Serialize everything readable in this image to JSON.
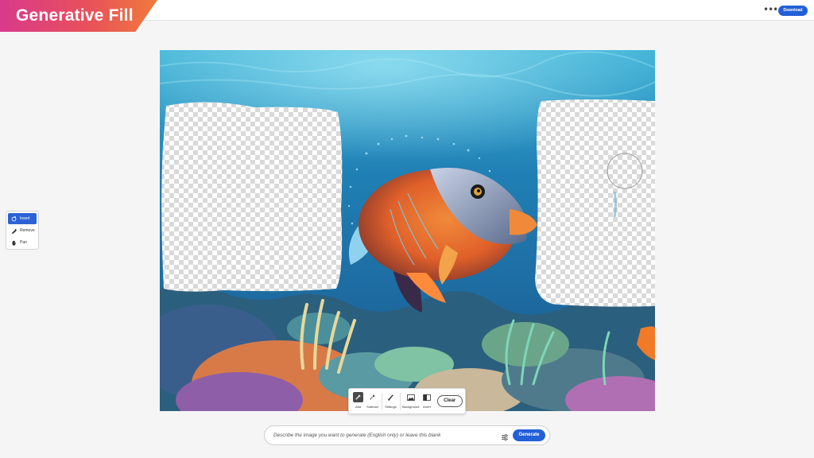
{
  "app": {
    "title": "Generative Fill",
    "brand_gradient": [
      "#d93a8c",
      "#f07a3c"
    ],
    "accent": "#2360d8"
  },
  "header": {
    "more_icon": "ellipsis-icon",
    "more_label": "•••",
    "download_label": "Download"
  },
  "tool_panel": {
    "items": [
      {
        "label": "Insert",
        "icon": "insert-brush-icon",
        "active": true
      },
      {
        "label": "Remove",
        "icon": "remove-brush-icon",
        "active": false
      },
      {
        "label": "Pan",
        "icon": "hand-icon",
        "active": false
      }
    ]
  },
  "brush_toolbar": {
    "tools": [
      {
        "label": "Add",
        "icon": "brush-add-icon",
        "active": true
      },
      {
        "label": "Subtract",
        "icon": "brush-subtract-icon",
        "active": false
      },
      {
        "label": "Settings",
        "icon": "brush-settings-icon",
        "active": false
      },
      {
        "label": "Background",
        "icon": "background-image-icon",
        "active": false
      },
      {
        "label": "Invert",
        "icon": "invert-icon",
        "active": false
      }
    ],
    "clear_label": "Clear"
  },
  "prompt": {
    "placeholder": "Describe the image you want to generate (English only) or leave this blank",
    "settings_icon": "sliders-icon",
    "generate_label": "Generate"
  }
}
